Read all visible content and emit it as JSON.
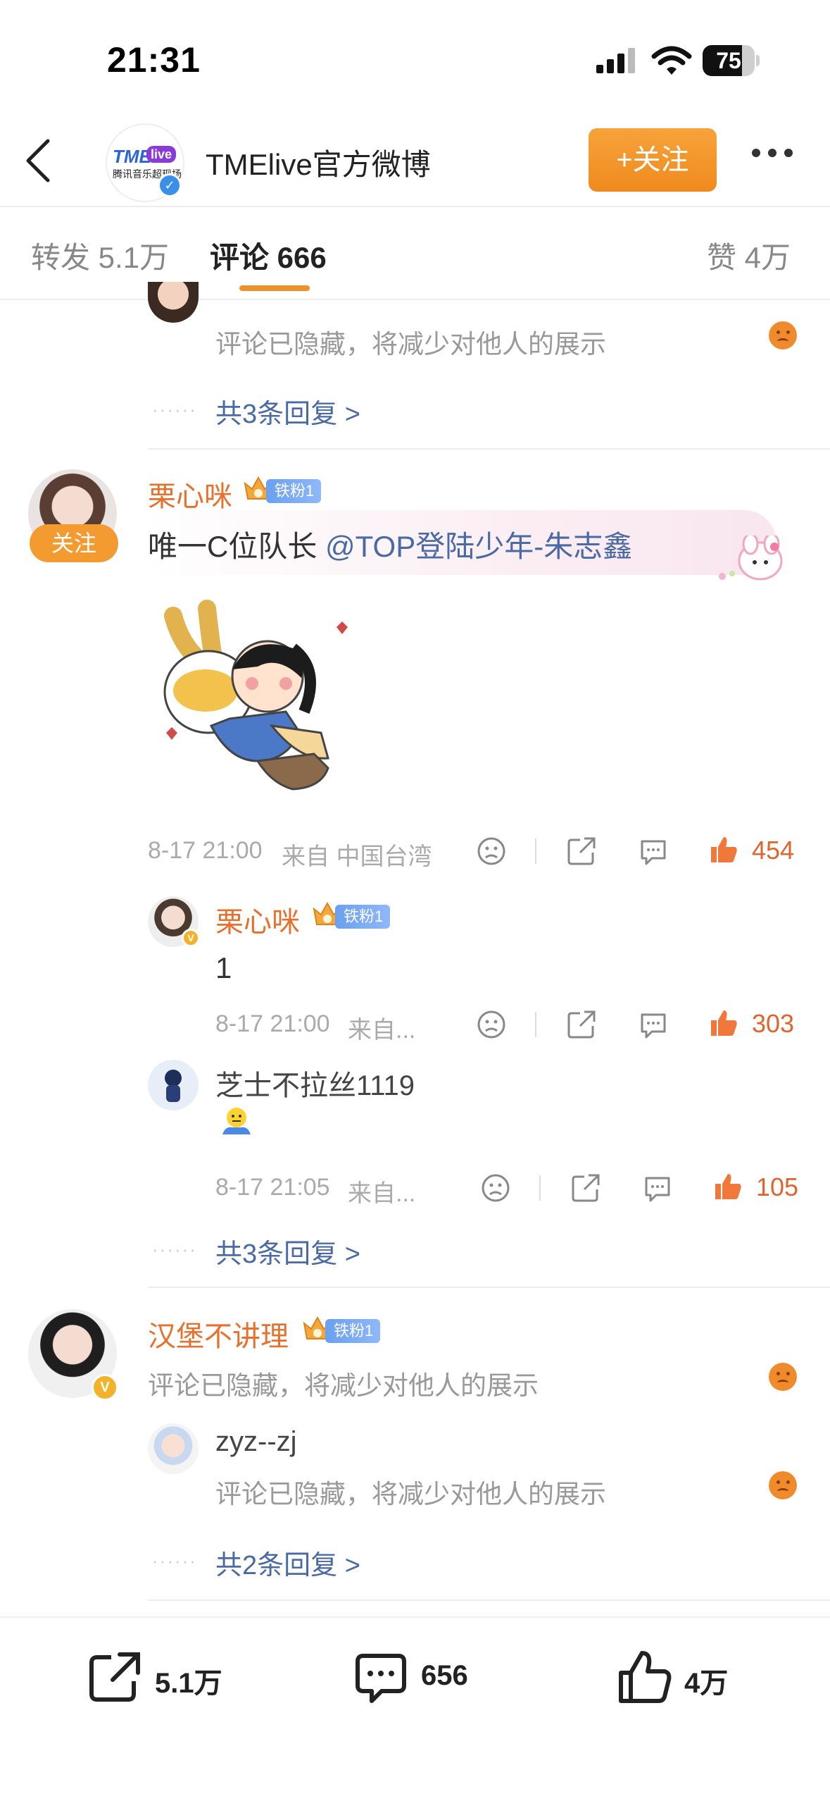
{
  "status_bar": {
    "time": "21:31",
    "battery": "75",
    "battery_level": 0.75
  },
  "header": {
    "title": "TMElive官方微博",
    "follow_label": "+关注",
    "logo_text": "TME",
    "logo_live": "live",
    "logo_sub": "腾讯音乐超现场"
  },
  "tabs": [
    {
      "label": "转发 5.1万"
    },
    {
      "label": "评论 666"
    },
    {
      "label": "赞 4万"
    }
  ],
  "comments": {
    "c0": {
      "hidden_text": "评论已隐藏，将减少对他人的展示",
      "reply_count": "共3条回复 >"
    },
    "c1": {
      "name": "栗心咪",
      "fan_badge": "铁粉1",
      "follow_label": "关注",
      "text_prefix": "唯一C位队长 ",
      "mention": "@TOP登陆少年-朱志鑫",
      "date": "8-17 21:00",
      "source": "来自 中国台湾",
      "likes": "454",
      "replies": [
        {
          "name": "栗心咪",
          "fan_badge": "铁粉1",
          "text": "1",
          "date": "8-17 21:00",
          "source": "来自...",
          "likes": "303"
        },
        {
          "name": "芝士不拉丝1119",
          "text": "",
          "date": "8-17 21:05",
          "source": "来自...",
          "likes": "105"
        }
      ],
      "reply_count": "共3条回复 >"
    },
    "c2": {
      "name": "汉堡不讲理",
      "fan_badge": "铁粉1",
      "hidden_text": "评论已隐藏，将减少对他人的展示",
      "replies": [
        {
          "name": "zyz--zj",
          "hidden_text": "评论已隐藏，将减少对他人的展示"
        }
      ],
      "reply_count": "共2条回复 >"
    }
  },
  "bottom_bar": {
    "share": "5.1万",
    "comment": "656",
    "like": "4万"
  },
  "dots_text": "······"
}
